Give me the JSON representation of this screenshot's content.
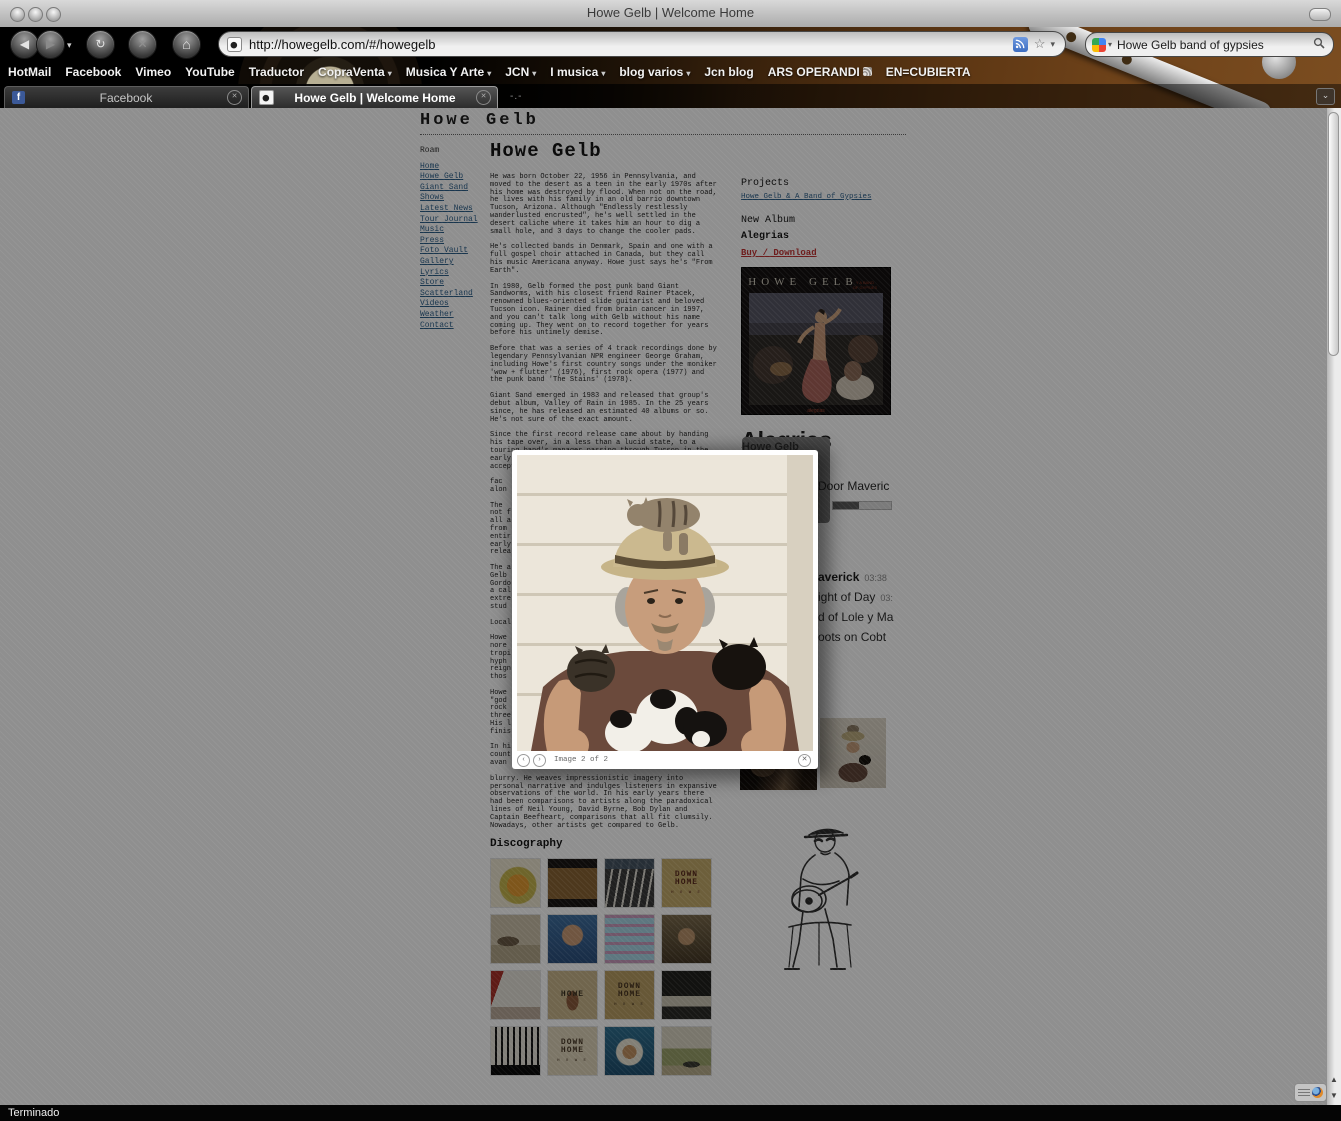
{
  "window": {
    "title": "Howe Gelb | Welcome Home"
  },
  "toolbar": {
    "url": "http://howegelb.com/#/howegelb",
    "search_value": "Howe Gelb band of gypsies"
  },
  "icons": {
    "back": "◀",
    "forward": "▶",
    "reload": "↻",
    "stop": "✕",
    "home": "⌂",
    "dropdown": "▾",
    "star": "☆",
    "tab_close": "✕",
    "tab_decor": "-.-",
    "list_tabs": "⌄",
    "prev": "‹",
    "next": "›",
    "close": "✕",
    "scroll_up": "▲",
    "scroll_down": "▼",
    "facebook": "f"
  },
  "bookmarks": [
    {
      "label": "HotMail"
    },
    {
      "label": "Facebook"
    },
    {
      "label": "Vimeo"
    },
    {
      "label": "YouTube"
    },
    {
      "label": "Traductor"
    },
    {
      "label": "CopraVenta"
    },
    {
      "label": "Musica Y Arte"
    },
    {
      "label": "JCN"
    },
    {
      "label": "I musica"
    },
    {
      "label": "blog varios"
    },
    {
      "label": "Jcn blog"
    },
    {
      "label": "ARS OPERANDI"
    },
    {
      "label": "EN=CUBIERTA"
    }
  ],
  "tabs": [
    {
      "label": "Facebook"
    },
    {
      "label": "Howe Gelb | Welcome Home"
    }
  ],
  "page": {
    "site_title": "Howe Gelb",
    "nav": {
      "heading": "Roam",
      "items": [
        {
          "label": "Home"
        },
        {
          "label": "Howe Gelb"
        },
        {
          "label": "Giant Sand"
        },
        {
          "label": "Shows"
        },
        {
          "label": "Latest News"
        },
        {
          "label": "Tour Journal"
        },
        {
          "label": "Music"
        },
        {
          "label": "Press"
        },
        {
          "label": "Foto Vault"
        },
        {
          "label": "Gallery"
        },
        {
          "label": "Lyrics"
        },
        {
          "label": "Store"
        },
        {
          "label": "Scatterland"
        },
        {
          "label": "Videos"
        },
        {
          "label": "Weather"
        },
        {
          "label": "Contact"
        }
      ]
    },
    "article": {
      "heading": "Howe Gelb",
      "paragraphs": [
        "He was born October 22, 1956 in Pennsylvania, and moved to the desert as a teen in the early 1970s after his home was destroyed by flood. When not on the road, he lives with his family in an old barrio downtown Tucson, Arizona. Although \"Endlessly restlessly wanderlusted encrusted\", he's well settled in the desert caliche where it takes him an hour to dig a small hole, and 3 days to change the cooler pads.",
        "He's collected bands in Denmark, Spain and one with a full gospel choir attached in Canada, but they call his music Americana anyway. Howe just says he's \"From Earth\".",
        "In 1980, Gelb formed the post punk band Giant Sandworms, with his closest friend Rainer Ptacek, renowned blues-oriented slide guitarist and beloved Tucson icon. Rainer died from brain cancer in 1997, and you can't talk long with Gelb without his name coming up. They went on to record together for years before his untimely demise.",
        "Before that was a series of 4 track recordings done by legendary Pennsylvanian NPR engineer George Graham, including Howe's first country songs under the moniker 'wow + flutter' (1976), first rock opera (1977) and the punk band 'The Stains' (1978).",
        "Giant Sand emerged in 1983 and released that group's debut album, Valley of Rain in 1985. In the 25 years since, he has released an estimated 40 albums or so. He's not sure of the exact amount.",
        "Since the first record release came about by handing his tape over, in a less than a lucid state, to a touring band's manager passing through Tucson in the early 80s, so had he continued the tradition by accepting the demos and"
      ],
      "hidden_fragments": "fac\nalon\n\nThe\nnot f\nall a\nfrom\nentir\nearly\nrelea\n\nThe a\nGelb\nGordo\na cal\nextre\nstud\n\nLocal\n\nHowe\nnore\ntropi\nhyph\nreign\nthos\n\nHowe\n\"god\nrock\nthree\nHis l\nfinis\n\nIn hi\ncount\navan",
      "visible_tail": "blurry. He weaves impressionistic imagery into personal narrative and indulges listeners in expansive observations of the world. In his early years there had been comparisons to artists along the paradoxical lines of Neil Young, David Byrne, Bob Dylan and Captain Beefheart, comparisons that all fit clumsily. Nowadays, other artists get compared to Gelb."
    },
    "discography": {
      "heading": "Discography",
      "thumbs": [
        {
          "name": "cartoon-figure-cream-cover",
          "line1": "",
          "line2": "",
          "line3": ""
        },
        {
          "name": "filmstrip-desert-cover",
          "line1": "",
          "line2": "",
          "line3": ""
        },
        {
          "name": "dark-striped-cover",
          "line1": "",
          "line2": "",
          "line3": ""
        },
        {
          "name": "down-home-tan-cover",
          "line1": "DOWN",
          "line2": "HOME",
          "line3": "H O W E"
        },
        {
          "name": "beige-landscape-cover",
          "line1": "",
          "line2": "",
          "line3": ""
        },
        {
          "name": "blue-face-cover",
          "line1": "",
          "line2": "",
          "line3": ""
        },
        {
          "name": "lightblue-pink-cover",
          "line1": "",
          "line2": "",
          "line3": ""
        },
        {
          "name": "down-home-cap-cover",
          "line1": "",
          "line2": "",
          "line3": ""
        },
        {
          "name": "white-red-room-cover",
          "line1": "",
          "line2": "",
          "line3": ""
        },
        {
          "name": "howe-figure-cover",
          "line1": "HOWE",
          "line2": "",
          "line3": ""
        },
        {
          "name": "down-home-large-cover",
          "line1": "DOWN",
          "line2": "HOME",
          "line3": "H O W E"
        },
        {
          "name": "dark-landscape-strip-cover",
          "line1": "",
          "line2": "",
          "line3": ""
        },
        {
          "name": "piano-keys-dark-cover",
          "line1": "",
          "line2": "",
          "line3": ""
        },
        {
          "name": "down-home-cream-cover",
          "line1": "DOWN",
          "line2": "HOME",
          "line3": "H O W E"
        },
        {
          "name": "blue-framed-photo-cover",
          "line1": "",
          "line2": "",
          "line3": ""
        },
        {
          "name": "landscape-with-car-cover",
          "line1": "",
          "line2": "",
          "line3": ""
        }
      ]
    },
    "sidebar": {
      "projects_heading": "Projects",
      "project_link": "Howe Gelb & A Band of Gypsies",
      "new_album_label": "New Album",
      "album_name": "Alegrias",
      "buy_link": "Buy / Download",
      "cover_artist": "HOWE GELB",
      "cover_subtitle": "Y A BAND OF GYPSIES",
      "cover_bottom": "alegrias",
      "album_heading": "Alegrias",
      "player": {
        "title_fragment": "Howe Gelb",
        "now_playing_fragment": "Door Maveric",
        "progress_fraction": 0.45,
        "tracks": [
          {
            "title_fragment": "averick",
            "time": "03:38"
          },
          {
            "title_fragment": "ight of Day",
            "time": "03:"
          },
          {
            "title_fragment": "d of Lole y Ma",
            "time": ""
          },
          {
            "title_fragment": "oots on Cobt",
            "time": ""
          }
        ]
      }
    }
  },
  "lightbox": {
    "caption": "Image 2 of 2"
  },
  "statusbar": {
    "text": "Terminado"
  },
  "colors": {
    "link": "#2c5f8a",
    "buy_link": "#c03030",
    "rss_icon": "#4a7fd4",
    "facebook_icon": "#3b5998",
    "statusbar_bg": "#050505"
  }
}
